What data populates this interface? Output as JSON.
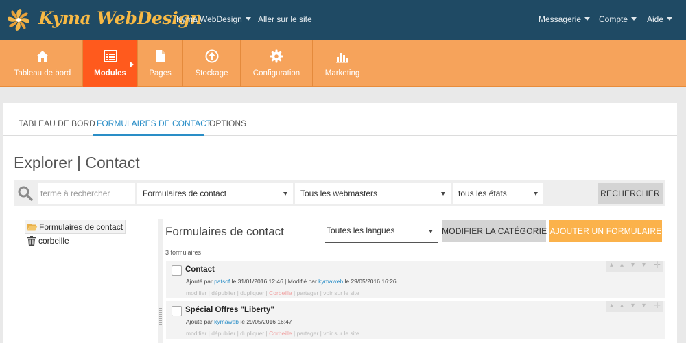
{
  "header": {
    "brand": "Kyma WebDesign",
    "site_menu": "Kyma WebDesign",
    "visit_site": "Aller sur le site",
    "messaging": "Messagerie",
    "account": "Compte",
    "help": "Aide"
  },
  "main_menu": [
    {
      "label": "Tableau de bord",
      "icon": "home-icon"
    },
    {
      "label": "Modules",
      "icon": "list-icon",
      "active": true
    },
    {
      "label": "Pages",
      "icon": "page-icon"
    },
    {
      "label": "Stockage",
      "icon": "upload-icon"
    },
    {
      "label": "Configuration",
      "icon": "gear-icon"
    },
    {
      "label": "Marketing",
      "icon": "bar-chart-icon"
    }
  ],
  "subtabs": [
    "TABLEAU DE BORD",
    "FORMULAIRES DE CONTACT",
    "OPTIONS"
  ],
  "page_title": "Explorer | Contact",
  "search": {
    "placeholder": "terme à rechercher",
    "category": "Formulaires de contact",
    "webmasters": "Tous les webmasters",
    "states": "tous les états",
    "button": "RECHERCHER"
  },
  "tree": [
    {
      "label": "Formulaires de contact",
      "icon": "folder-open-icon"
    },
    {
      "label": "corbeille",
      "icon": "trash-icon"
    }
  ],
  "list": {
    "title": "Formulaires de contact",
    "language": "Toutes les langues",
    "modify_button": "MODIFIER LA CATÉGORIE",
    "add_button": "AJOUTER UN FORMULAIRE",
    "count": "3 formulaires",
    "items": [
      {
        "title": "Contact",
        "added_prefix": "Ajouté par",
        "added_by": "patsof",
        "added_on": "le 31/01/2016 12:46 | Modifié par",
        "modified_by": "kymaweb",
        "modified_on": "le 29/05/2016 16:26"
      },
      {
        "title": "Spécial Offres \"Liberty\"",
        "added_prefix": "Ajouté par",
        "added_by": "kymaweb",
        "added_on": "le 29/05/2016 16:47"
      }
    ],
    "actions": {
      "modify": "modifier",
      "unpublish": "dépublier",
      "duplicate": "dupliquer",
      "trash": "Corbeille",
      "share": "partager",
      "view": "voir sur le site",
      "sep": "|"
    }
  },
  "colors": {
    "topbar": "#1f4a64",
    "brand": "#f7b945",
    "menu": "#f6a35b",
    "menu_active": "#ff5a1d",
    "accent": "#2a8ec7",
    "add_button": "#fbb24b"
  }
}
